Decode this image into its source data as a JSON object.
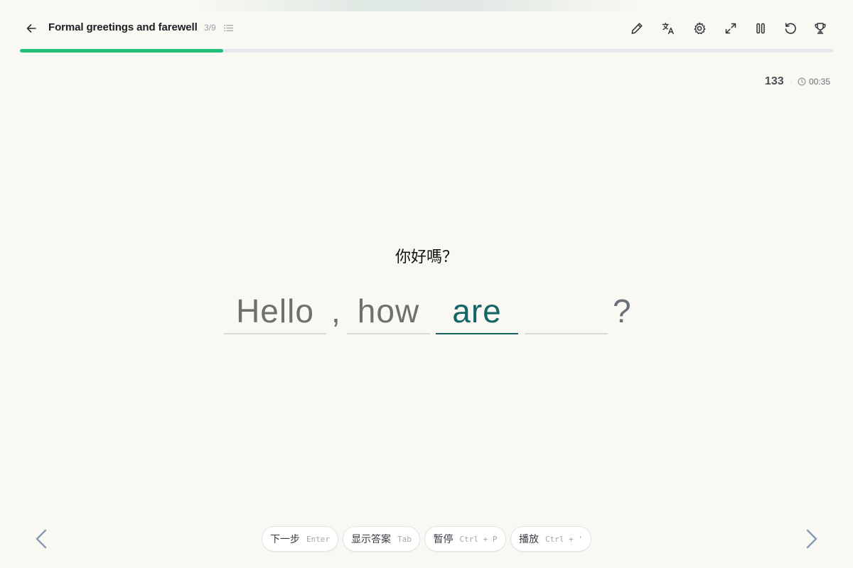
{
  "header": {
    "title": "Formal greetings and farewell",
    "progress_text": "3/9",
    "progress_fraction": 0.25
  },
  "toolbar": [
    {
      "name": "edit-icon"
    },
    {
      "name": "translate-icon"
    },
    {
      "name": "settings-icon"
    },
    {
      "name": "fullscreen-icon"
    },
    {
      "name": "pause-icon"
    },
    {
      "name": "restart-icon"
    },
    {
      "name": "trophy-icon"
    }
  ],
  "stats": {
    "score": "133",
    "separator": "·",
    "timer": "00:35"
  },
  "exercise": {
    "prompt": "你好嗎？",
    "words": [
      "Hello",
      "how",
      "are",
      ""
    ],
    "separator": ",",
    "end_punctuation": "?",
    "active_index": 2
  },
  "controls": [
    {
      "label": "下一步",
      "key": "Enter"
    },
    {
      "label": "显示答案",
      "key": "Tab"
    },
    {
      "label": "暂停",
      "key": "Ctrl + P"
    },
    {
      "label": "播放",
      "key": "Ctrl + '"
    }
  ],
  "colors": {
    "background": "#f9f8f3",
    "progress": "#20c07a",
    "active_word": "#146566",
    "nav_arrow": "#8a9ab5"
  }
}
